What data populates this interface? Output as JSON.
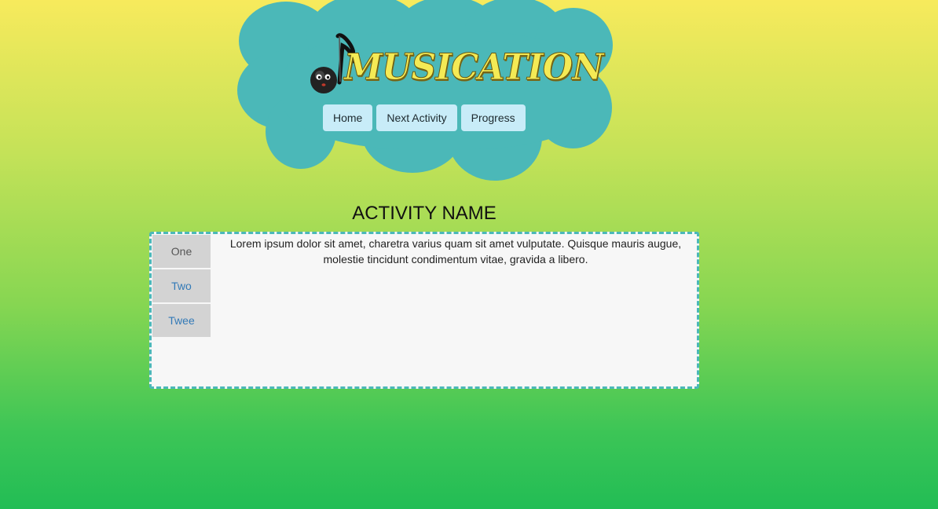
{
  "header": {
    "logo_text": "MUSICATION",
    "nav": [
      {
        "label": "Home"
      },
      {
        "label": "Next Activity"
      },
      {
        "label": "Progress"
      }
    ]
  },
  "activity": {
    "title": "ACTIVITY NAME",
    "tabs": [
      {
        "label": "One",
        "active": true
      },
      {
        "label": "Two",
        "active": false
      },
      {
        "label": "Twee",
        "active": false
      }
    ],
    "body_text": "Lorem ipsum dolor sit amet, charetra varius quam sit amet vulputate. Quisque mauris augue, molestie tincidunt condimentum vitae, gravida a libero."
  },
  "colors": {
    "cloud": "#4bb8b8",
    "nav_button": "#c8ecf8",
    "tab_bg": "#d3d3d3",
    "tab_link": "#337ab7",
    "logo_yellow": "#f4ea55"
  },
  "icons": {
    "logo_icon": "music-note-icon"
  }
}
